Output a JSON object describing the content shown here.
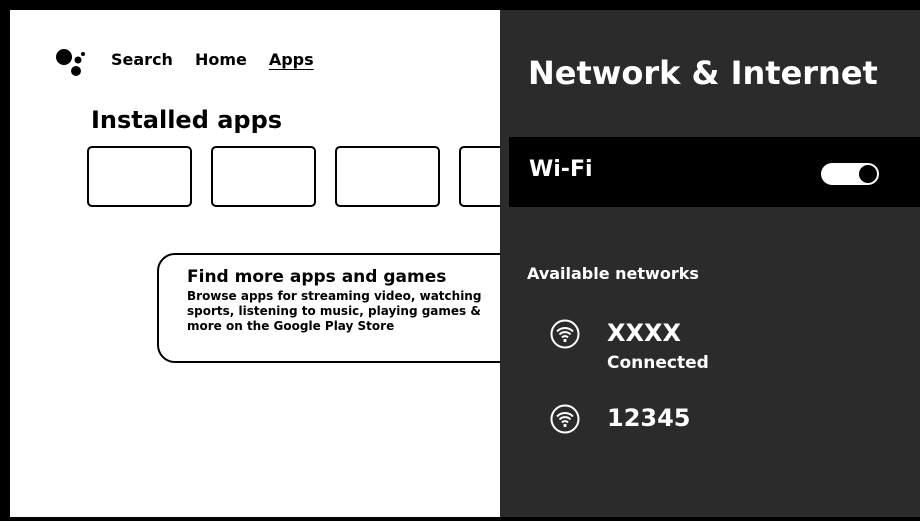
{
  "home": {
    "nav": [
      "Search",
      "Home",
      "Apps"
    ],
    "active_tab": "Apps",
    "installed_title": "Installed apps",
    "promo": {
      "title": "Find more apps and games",
      "description": "Browse apps for streaming video, watching sports, listening to music, playing games & more on the Google Play Store"
    }
  },
  "settings": {
    "title": "Network & Internet",
    "wifi_label": "Wi-Fi",
    "wifi_enabled": true,
    "available_label": "Available networks",
    "networks": [
      {
        "name": "XXXX",
        "status": "Connected",
        "icon": "wifi-icon"
      },
      {
        "name": "12345",
        "status": "",
        "icon": "wifi-icon"
      }
    ]
  },
  "colors": {
    "panel_bg": "#2b2b2b",
    "row_bg": "#000000",
    "frame": "#000000"
  }
}
